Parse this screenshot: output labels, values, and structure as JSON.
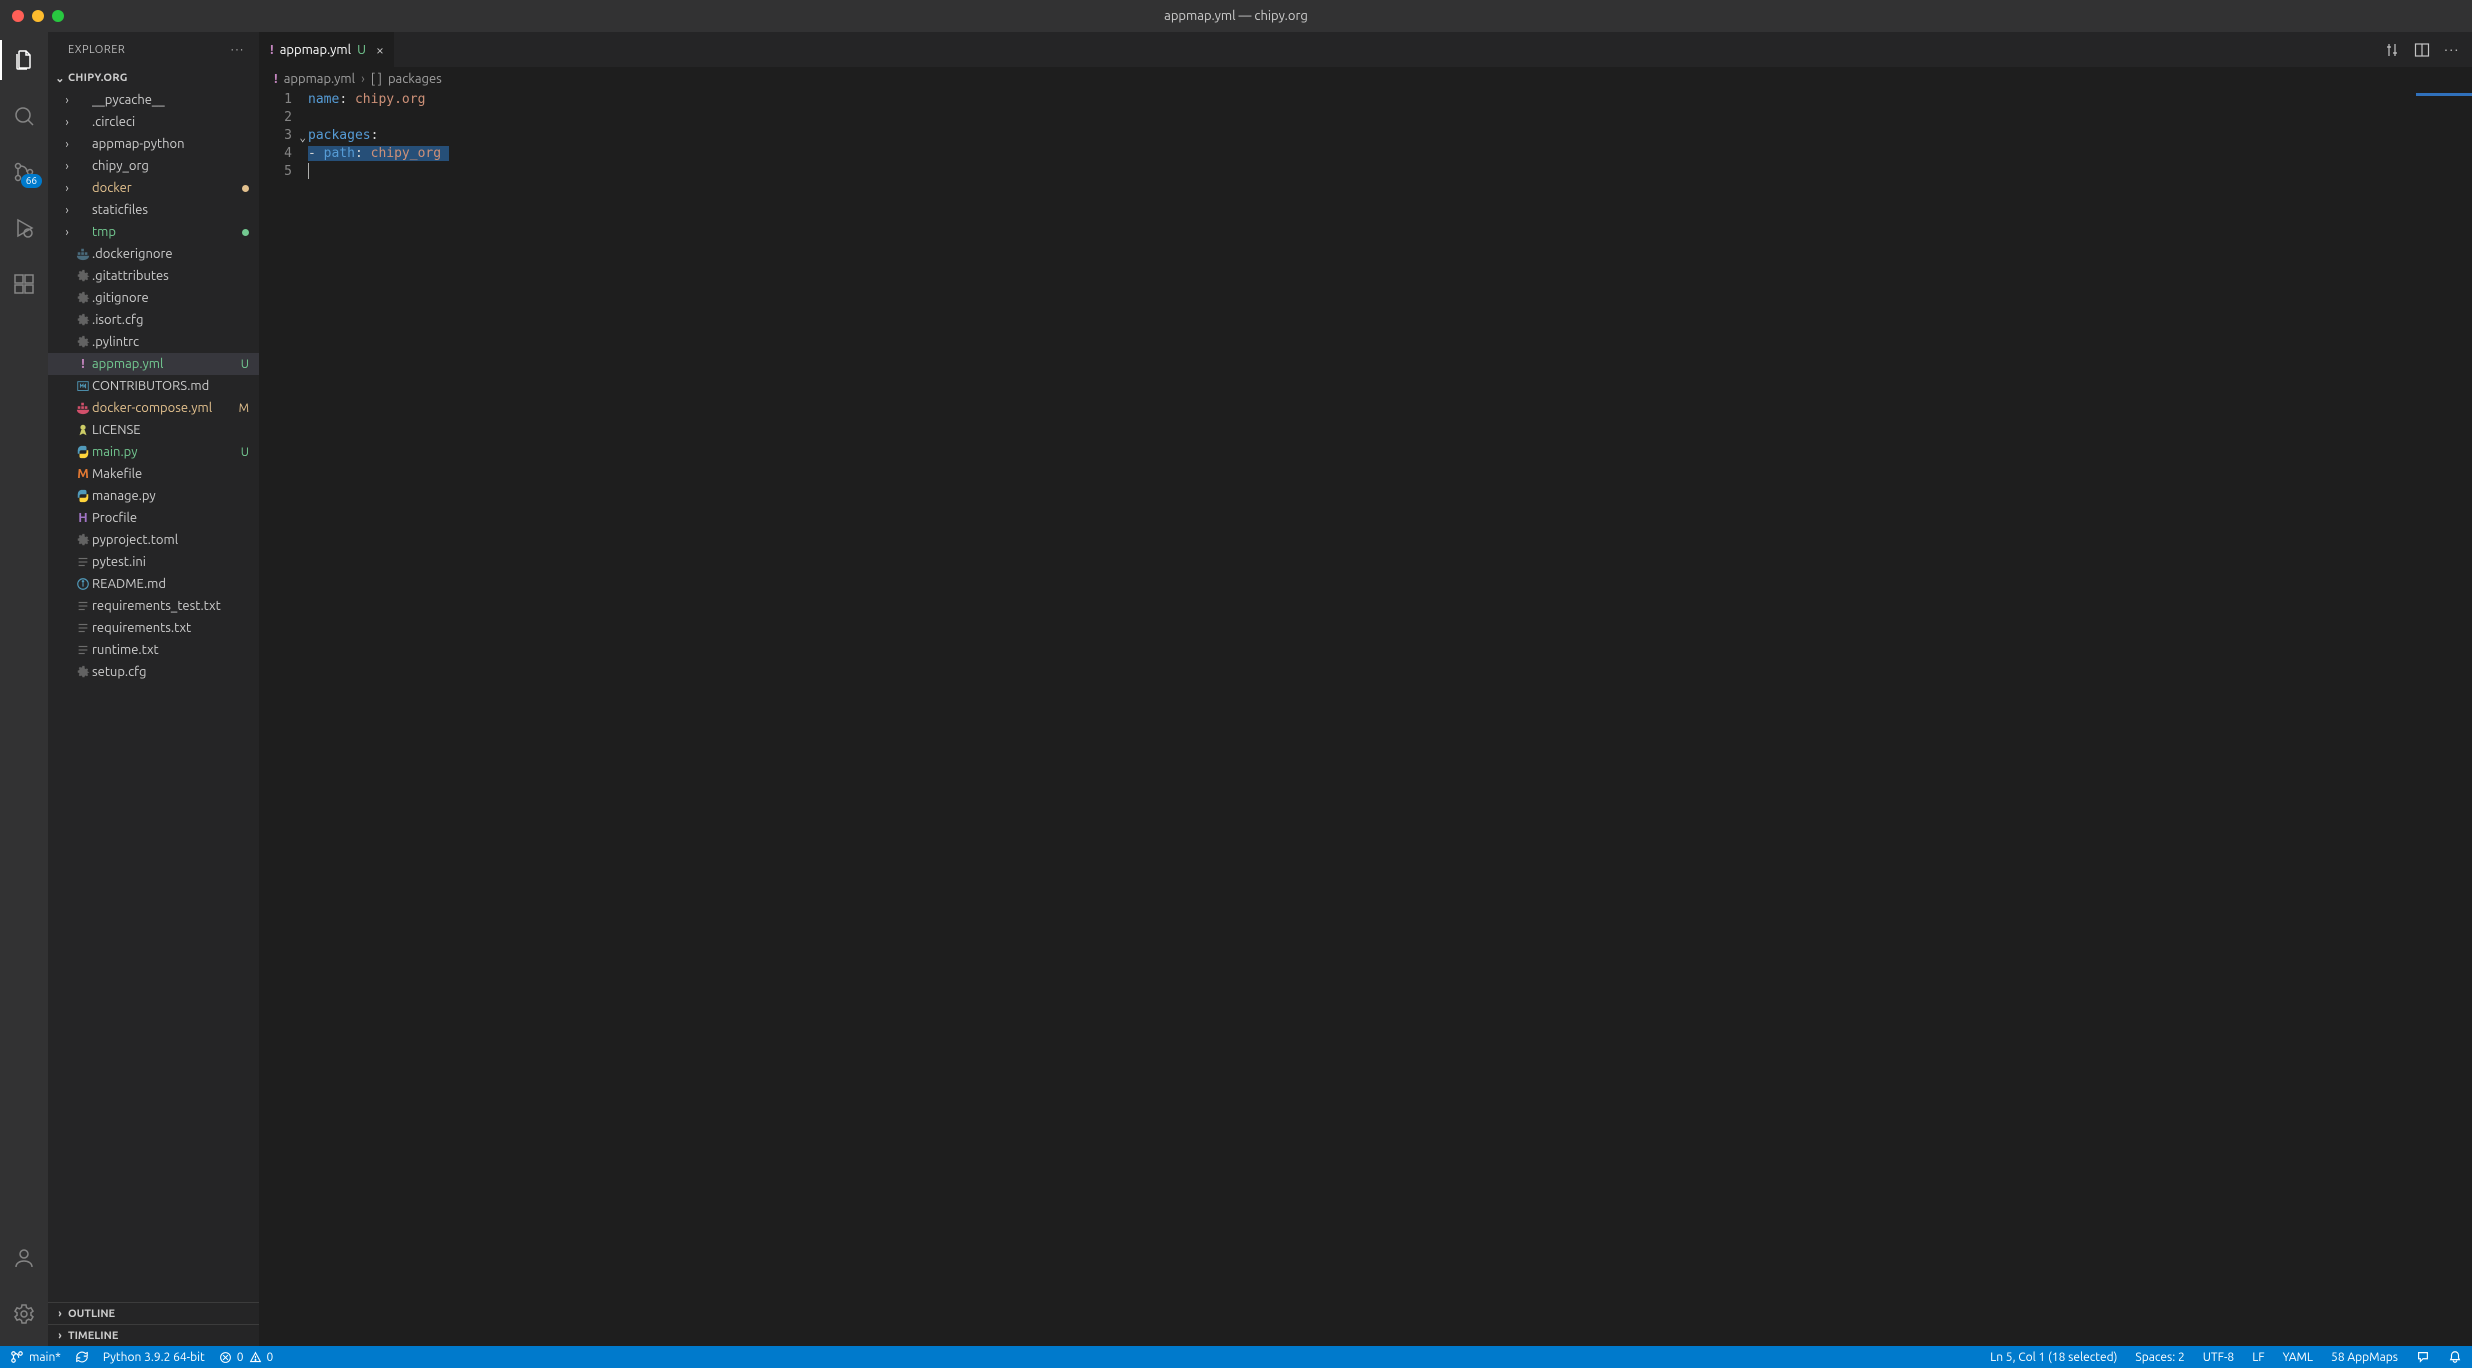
{
  "window": {
    "title": "appmap.yml — chipy.org"
  },
  "traffic": {
    "close": "#ff5f57",
    "min": "#febc2e",
    "max": "#28c840"
  },
  "activitybar": {
    "items": [
      {
        "name": "explorer",
        "active": true
      },
      {
        "name": "search"
      },
      {
        "name": "scm",
        "badge": "66"
      },
      {
        "name": "run-debug"
      },
      {
        "name": "extensions"
      }
    ],
    "bottom": [
      {
        "name": "accounts"
      },
      {
        "name": "settings-gear"
      }
    ]
  },
  "sidebar": {
    "title": "EXPLORER",
    "root": "CHIPY.ORG",
    "collapsed_sections": [
      {
        "label": "OUTLINE"
      },
      {
        "label": "TIMELINE"
      }
    ],
    "tree": [
      {
        "kind": "folder",
        "label": "__pycache__",
        "indent": 1
      },
      {
        "kind": "folder",
        "label": ".circleci",
        "indent": 1
      },
      {
        "kind": "folder",
        "label": "appmap-python",
        "indent": 1
      },
      {
        "kind": "folder",
        "label": "chipy_org",
        "indent": 1
      },
      {
        "kind": "folder",
        "label": "docker",
        "indent": 1,
        "git": "m",
        "dot": "#e2c08d"
      },
      {
        "kind": "folder",
        "label": "staticfiles",
        "indent": 1
      },
      {
        "kind": "folder",
        "label": "tmp",
        "indent": 1,
        "git": "u",
        "dot": "#73c991"
      },
      {
        "kind": "file",
        "label": ".dockerignore",
        "indent": 1,
        "icon": "docker",
        "iconColor": "#4a6b7c"
      },
      {
        "kind": "file",
        "label": ".gitattributes",
        "indent": 1,
        "icon": "gear",
        "iconColor": "#6d6d6d"
      },
      {
        "kind": "file",
        "label": ".gitignore",
        "indent": 1,
        "icon": "gear",
        "iconColor": "#6d6d6d"
      },
      {
        "kind": "file",
        "label": ".isort.cfg",
        "indent": 1,
        "icon": "gear",
        "iconColor": "#6d6d6d"
      },
      {
        "kind": "file",
        "label": ".pylintrc",
        "indent": 1,
        "icon": "gear",
        "iconColor": "#6d6d6d"
      },
      {
        "kind": "file",
        "label": "appmap.yml",
        "indent": 1,
        "icon": "bang",
        "iconColor": "#c586c0",
        "git": "u",
        "decor": "U",
        "selected": true
      },
      {
        "kind": "file",
        "label": "CONTRIBUTORS.md",
        "indent": 1,
        "icon": "md",
        "iconColor": "#519aba"
      },
      {
        "kind": "file",
        "label": "docker-compose.yml",
        "indent": 1,
        "icon": "docker",
        "iconColor": "#d2506b",
        "git": "m",
        "decor": "M"
      },
      {
        "kind": "file",
        "label": "LICENSE",
        "indent": 1,
        "icon": "license",
        "iconColor": "#cccc66"
      },
      {
        "kind": "file",
        "label": "main.py",
        "indent": 1,
        "icon": "py",
        "iconColor": "#519aba",
        "git": "u",
        "decor": "U"
      },
      {
        "kind": "file",
        "label": "Makefile",
        "indent": 1,
        "icon": "make",
        "iconColor": "#e37933"
      },
      {
        "kind": "file",
        "label": "manage.py",
        "indent": 1,
        "icon": "py",
        "iconColor": "#519aba"
      },
      {
        "kind": "file",
        "label": "Procfile",
        "indent": 1,
        "icon": "proc",
        "iconColor": "#a074c4"
      },
      {
        "kind": "file",
        "label": "pyproject.toml",
        "indent": 1,
        "icon": "gear",
        "iconColor": "#6d6d6d"
      },
      {
        "kind": "file",
        "label": "pytest.ini",
        "indent": 1,
        "icon": "text",
        "iconColor": "#6d6d6d"
      },
      {
        "kind": "file",
        "label": "README.md",
        "indent": 1,
        "icon": "info",
        "iconColor": "#519aba"
      },
      {
        "kind": "file",
        "label": "requirements_test.txt",
        "indent": 1,
        "icon": "text",
        "iconColor": "#6d6d6d"
      },
      {
        "kind": "file",
        "label": "requirements.txt",
        "indent": 1,
        "icon": "text",
        "iconColor": "#6d6d6d"
      },
      {
        "kind": "file",
        "label": "runtime.txt",
        "indent": 1,
        "icon": "text",
        "iconColor": "#6d6d6d"
      },
      {
        "kind": "file",
        "label": "setup.cfg",
        "indent": 1,
        "icon": "gear",
        "iconColor": "#6d6d6d"
      }
    ]
  },
  "tab": {
    "filename": "appmap.yml",
    "status": "U"
  },
  "breadcrumbs": {
    "file": "appmap.yml",
    "symbol": "packages"
  },
  "editor": {
    "lines": [
      {
        "n": 1,
        "segments": [
          {
            "t": "name",
            "c": "key"
          },
          {
            "t": ":",
            "c": "punc"
          },
          {
            "t": " ",
            "c": "punc"
          },
          {
            "t": "chipy.org",
            "c": "str"
          }
        ]
      },
      {
        "n": 2,
        "segments": []
      },
      {
        "n": 3,
        "fold": true,
        "segments": [
          {
            "t": "packages",
            "c": "key"
          },
          {
            "t": ":",
            "c": "punc"
          }
        ]
      },
      {
        "n": 4,
        "selected": true,
        "segments": [
          {
            "t": "- ",
            "c": "punc"
          },
          {
            "t": "path",
            "c": "key"
          },
          {
            "t": ":",
            "c": "punc"
          },
          {
            "t": " ",
            "c": "punc"
          },
          {
            "t": "chipy_org",
            "c": "str"
          }
        ]
      },
      {
        "n": 5,
        "cursor": true,
        "segments": []
      }
    ]
  },
  "status": {
    "branch": "main*",
    "python": "Python 3.9.2 64-bit",
    "errors": "0",
    "warnings": "0",
    "cursor": "Ln 5, Col 1 (18 selected)",
    "spaces": "Spaces: 2",
    "encoding": "UTF-8",
    "eol": "LF",
    "lang": "YAML",
    "appmaps": "58 AppMaps"
  }
}
